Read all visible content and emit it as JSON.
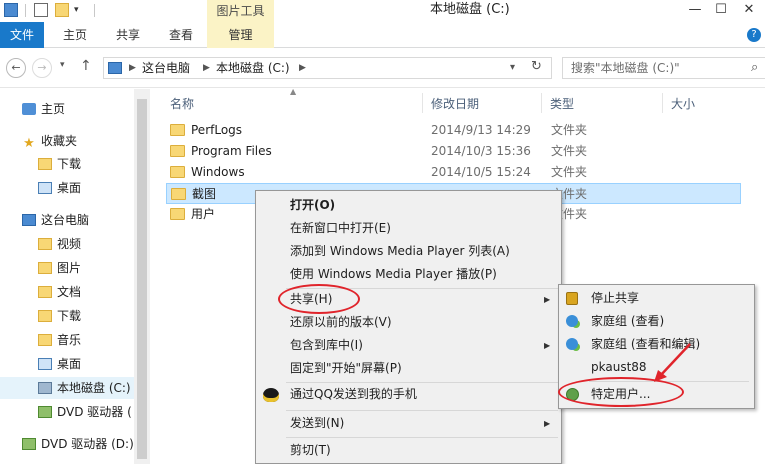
{
  "window": {
    "title": "本地磁盘 (C:)",
    "tools_tab": "图片工具",
    "minimize": "—",
    "maximize": "☐",
    "close": "✕"
  },
  "ribbon": {
    "tabs": [
      "文件",
      "主页",
      "共享",
      "查看",
      "管理"
    ],
    "help": "?"
  },
  "address": {
    "crumbs": [
      "这台电脑",
      "本地磁盘 (C:)"
    ],
    "search_placeholder": "搜索\"本地磁盘 (C:)\""
  },
  "nav": {
    "items": [
      {
        "label": "主页",
        "icon": "home-icon"
      },
      {
        "label": "收藏夹",
        "icon": "star-icon"
      },
      {
        "label": "下载",
        "icon": "download-folder-icon"
      },
      {
        "label": "桌面",
        "icon": "desktop-icon"
      },
      {
        "label": "这台电脑",
        "icon": "computer-icon"
      },
      {
        "label": "视频",
        "icon": "video-folder-icon"
      },
      {
        "label": "图片",
        "icon": "picture-folder-icon"
      },
      {
        "label": "文档",
        "icon": "document-folder-icon"
      },
      {
        "label": "下载",
        "icon": "download-folder-icon"
      },
      {
        "label": "音乐",
        "icon": "music-folder-icon"
      },
      {
        "label": "桌面",
        "icon": "desktop-icon"
      },
      {
        "label": "本地磁盘 (C:)",
        "icon": "drive-icon"
      },
      {
        "label": "DVD 驱动器 (",
        "icon": "dvd-icon"
      },
      {
        "label": "DVD 驱动器 (D:)",
        "icon": "dvd-icon"
      }
    ]
  },
  "columns": {
    "name": "名称",
    "date": "修改日期",
    "type": "类型",
    "size": "大小"
  },
  "files": [
    {
      "name": "PerfLogs",
      "date": "2014/9/13 14:29",
      "type": "文件夹"
    },
    {
      "name": "Program Files",
      "date": "2014/10/3 15:36",
      "type": "文件夹"
    },
    {
      "name": "Windows",
      "date": "2014/10/5 15:24",
      "type": "文件夹"
    },
    {
      "name": "截图",
      "date": "",
      "type": "文件夹"
    },
    {
      "name": "用户",
      "date": "",
      "type": "文件夹"
    }
  ],
  "context_menu": {
    "items": [
      "打开(O)",
      "在新窗口中打开(E)",
      "添加到 Windows Media Player 列表(A)",
      "使用 Windows Media Player 播放(P)",
      "共享(H)",
      "还原以前的版本(V)",
      "包含到库中(I)",
      "固定到\"开始\"屏幕(P)",
      "通过QQ发送到我的手机",
      "发送到(N)",
      "剪切(T)"
    ]
  },
  "share_submenu": {
    "items": [
      {
        "label": "停止共享",
        "icon": "lock-icon"
      },
      {
        "label": "家庭组 (查看)",
        "icon": "homegroup-icon"
      },
      {
        "label": "家庭组 (查看和编辑)",
        "icon": "homegroup-icon"
      },
      {
        "label": "pkaust88",
        "icon": ""
      },
      {
        "label": "特定用户...",
        "icon": "users-icon"
      }
    ]
  },
  "colors": {
    "accent": "#1979ca",
    "tools_tab": "#fbf3c6",
    "selection": "#cce8ff",
    "annotation": "#e0242b"
  }
}
